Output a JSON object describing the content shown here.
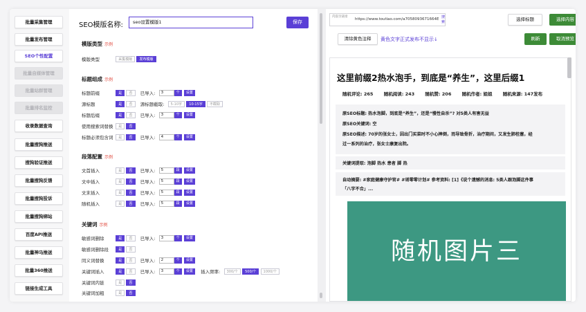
{
  "sidebar": {
    "items": [
      {
        "label": "批量采集管理",
        "state": "normal"
      },
      {
        "label": "批量发布管理",
        "state": "normal"
      },
      {
        "label": "SEO个性配置",
        "state": "active"
      },
      {
        "label": "批量自媒体管理",
        "state": "disabled"
      },
      {
        "label": "批量站群管理",
        "state": "disabled"
      },
      {
        "label": "批量排名监控",
        "state": "disabled"
      },
      {
        "label": "收录数据查询",
        "state": "normal"
      },
      {
        "label": "批量搜狗推送",
        "state": "normal"
      },
      {
        "label": "搜狗验证推送",
        "state": "normal"
      },
      {
        "label": "批量搜狗反馈",
        "state": "normal"
      },
      {
        "label": "批量搜狗投诉",
        "state": "normal"
      },
      {
        "label": "批量搜狗绑站",
        "state": "normal"
      },
      {
        "label": "百度API推送",
        "state": "normal"
      },
      {
        "label": "批量神马推送",
        "state": "normal"
      },
      {
        "label": "批量360推送",
        "state": "normal"
      },
      {
        "label": "链接生成工具",
        "state": "normal"
      }
    ]
  },
  "editor": {
    "name_label": "SEO模版名称:",
    "name_value": "seo设置模版1",
    "save_label": "保存",
    "example": "示例",
    "imported_label": "已导入:",
    "setting": "设置",
    "section_type": {
      "title": "模版类型",
      "row_label": "模版类型",
      "options": [
        "采集模版",
        "发布模版"
      ]
    },
    "section_title": {
      "title": "标题组成",
      "rows": {
        "prefix": {
          "label": "标题前缀",
          "yes": "是",
          "no": "否",
          "count": "3",
          "unit": "个"
        },
        "source": {
          "label": "源标题",
          "yes": "是",
          "no": "否",
          "cut_label": "源标题截取:",
          "cut_options": [
            "5-10字",
            "10-15字",
            "不截取"
          ]
        },
        "suffix": {
          "label": "标题后缀",
          "yes": "是",
          "no": "否",
          "count": "3",
          "unit": "个"
        },
        "search_replace": {
          "label": "使用搜索词替换",
          "yes": "是",
          "no": "否"
        },
        "auto_combine": {
          "label": "标题必须包含词",
          "yes": "是",
          "no": "否",
          "count": "4",
          "unit": "个"
        }
      }
    },
    "section_para": {
      "title": "段落配置",
      "rows": [
        {
          "label": "文首插入",
          "yes": "是",
          "no": "否",
          "count": "5",
          "unit": "段"
        },
        {
          "label": "文中插入",
          "yes": "是",
          "no": "否",
          "count": "5",
          "unit": "段"
        },
        {
          "label": "文末插入",
          "yes": "是",
          "no": "否",
          "count": "5",
          "unit": "段"
        },
        {
          "label": "随机插入",
          "yes": "是",
          "no": "否",
          "count": "5",
          "unit": "段"
        }
      ]
    },
    "section_keyword": {
      "title": "关键词",
      "rows": {
        "sensitive_delete": {
          "label": "敏感词删除",
          "yes": "是",
          "no": "否",
          "count": "3",
          "unit": "个"
        },
        "sensitive_para": {
          "label": "敏感词删除段",
          "yes": "是",
          "no": "否"
        },
        "synonym": {
          "label": "同义词替换",
          "yes": "是",
          "no": "否",
          "count": "2",
          "unit": "个"
        },
        "kw_insert": {
          "label": "关键词插入",
          "yes": "是",
          "no": "否",
          "count": "3",
          "unit": "个",
          "freq_label": "插入频率:",
          "freq_options": [
            "300/个",
            "500/个",
            "1000/个"
          ]
        },
        "kw_internal": {
          "label": "关键词内链",
          "yes": "是",
          "no": "否"
        },
        "kw_bold": {
          "label": "关键词加粗",
          "yes": "是",
          "no": "否"
        }
      }
    }
  },
  "preview": {
    "url_label": "内容页链接",
    "url_value": "https://www.toutiao.com/a7058093671664E",
    "url_search": "搜索",
    "select_title": "选择标题",
    "select_content": "选择内容",
    "clear_yellow": "清除黄色注释",
    "yellow_note": "黄色文字正式发布不显示↓",
    "refresh": "刷新",
    "cancel_preview": "取消预览",
    "article": {
      "title": "这里前缀2热水泡手，到底是“养生”，这里后缀1",
      "meta": [
        "随机评论: 265",
        "随机阅读: 243",
        "随机赞: 206",
        "随机作者: 姐姐",
        "随机来源: 147发布"
      ],
      "seo_title": "原SEO标题: 热水泡脚，到底是“养生”，还是“慢性自杀”? 对5类人有害无益",
      "seo_keyword": "原SEO关键词: 空",
      "seo_desc_1": "原SEO描述: 70岁的张女士，因出门买菜时不小心摔倒，而导致骨折，治疗期间，又发生肺栓塞，经",
      "seo_desc_2": "过一系列的治疗，张女士康复出院。",
      "keywords": "关键词提取: 泡脚 热水 患者 脚 热",
      "abstract_1": "自动摘要: #家庭健康守护官# #谣零零计划# 参考资料: [1]《说个遗憾的消息: 5类人跟泡脚这件事",
      "abstract_2": "「八字不合」...",
      "image_text": "随机图片三"
    }
  }
}
